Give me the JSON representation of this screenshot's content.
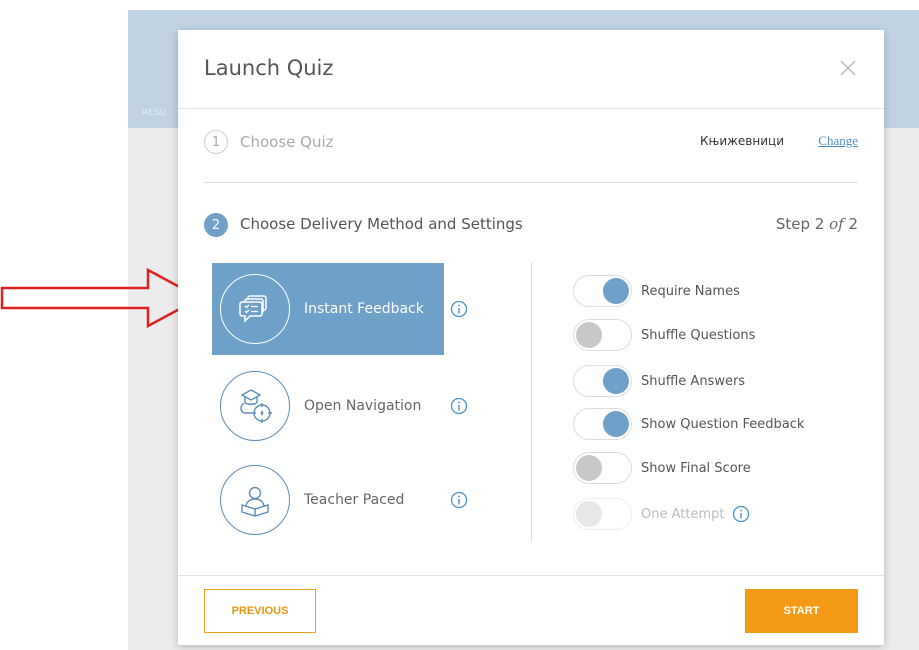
{
  "background": {
    "tab_label": "RESU"
  },
  "modal": {
    "title": "Launch Quiz",
    "close_icon": "close-icon"
  },
  "step1": {
    "number": "1",
    "label": "Choose Quiz",
    "quiz_name": "Књижевници",
    "change_label": "Change"
  },
  "step2": {
    "number": "2",
    "label": "Choose Delivery Method and Settings",
    "counter_prefix": "Step 2",
    "counter_of": "of",
    "counter_total": "2"
  },
  "delivery_methods": [
    {
      "label": "Instant Feedback",
      "icon": "feedback-cards-icon",
      "selected": true
    },
    {
      "label": "Open Navigation",
      "icon": "navigation-compass-icon",
      "selected": false
    },
    {
      "label": "Teacher Paced",
      "icon": "teacher-book-icon",
      "selected": false
    }
  ],
  "settings": [
    {
      "label": "Require Names",
      "state": "on"
    },
    {
      "label": "Shuffle Questions",
      "state": "off"
    },
    {
      "label": "Shuffle Answers",
      "state": "on"
    },
    {
      "label": "Show Question Feedback",
      "state": "on"
    },
    {
      "label": "Show Final Score",
      "state": "off"
    },
    {
      "label": "One Attempt",
      "state": "disabled",
      "has_info": true
    }
  ],
  "footer": {
    "previous_label": "PREVIOUS",
    "start_label": "START"
  },
  "colors": {
    "accent_blue": "#6fa0c8",
    "start_orange": "#f49a16",
    "link_blue": "#4a90c8",
    "annotation_red": "#e02020"
  }
}
